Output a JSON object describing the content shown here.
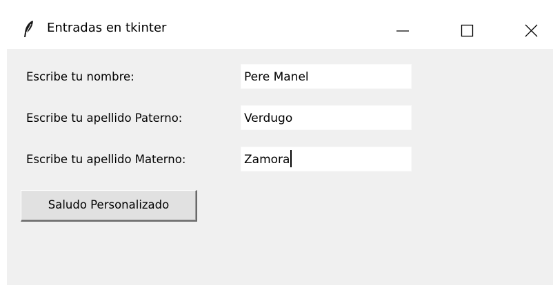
{
  "window": {
    "title": "Entradas en tkinter",
    "app_icon": "feather-icon",
    "controls": {
      "minimize_icon": "minimize-icon",
      "maximize_icon": "maximize-icon",
      "close_icon": "close-icon"
    }
  },
  "form": {
    "nombre": {
      "label": "Escribe tu nombre:",
      "value": "Pere Manel"
    },
    "apellido_paterno": {
      "label": "Escribe tu apellido Paterno:",
      "value": "Verdugo"
    },
    "apellido_materno": {
      "label": "Escribe tu apellido Materno:",
      "value": "Zamora"
    },
    "button_label": "Saludo Personalizado"
  },
  "colors": {
    "window_background": "#f0f0f0",
    "titlebar_background": "#ffffff",
    "entry_background": "#ffffff",
    "button_background": "#e1e1e1"
  }
}
